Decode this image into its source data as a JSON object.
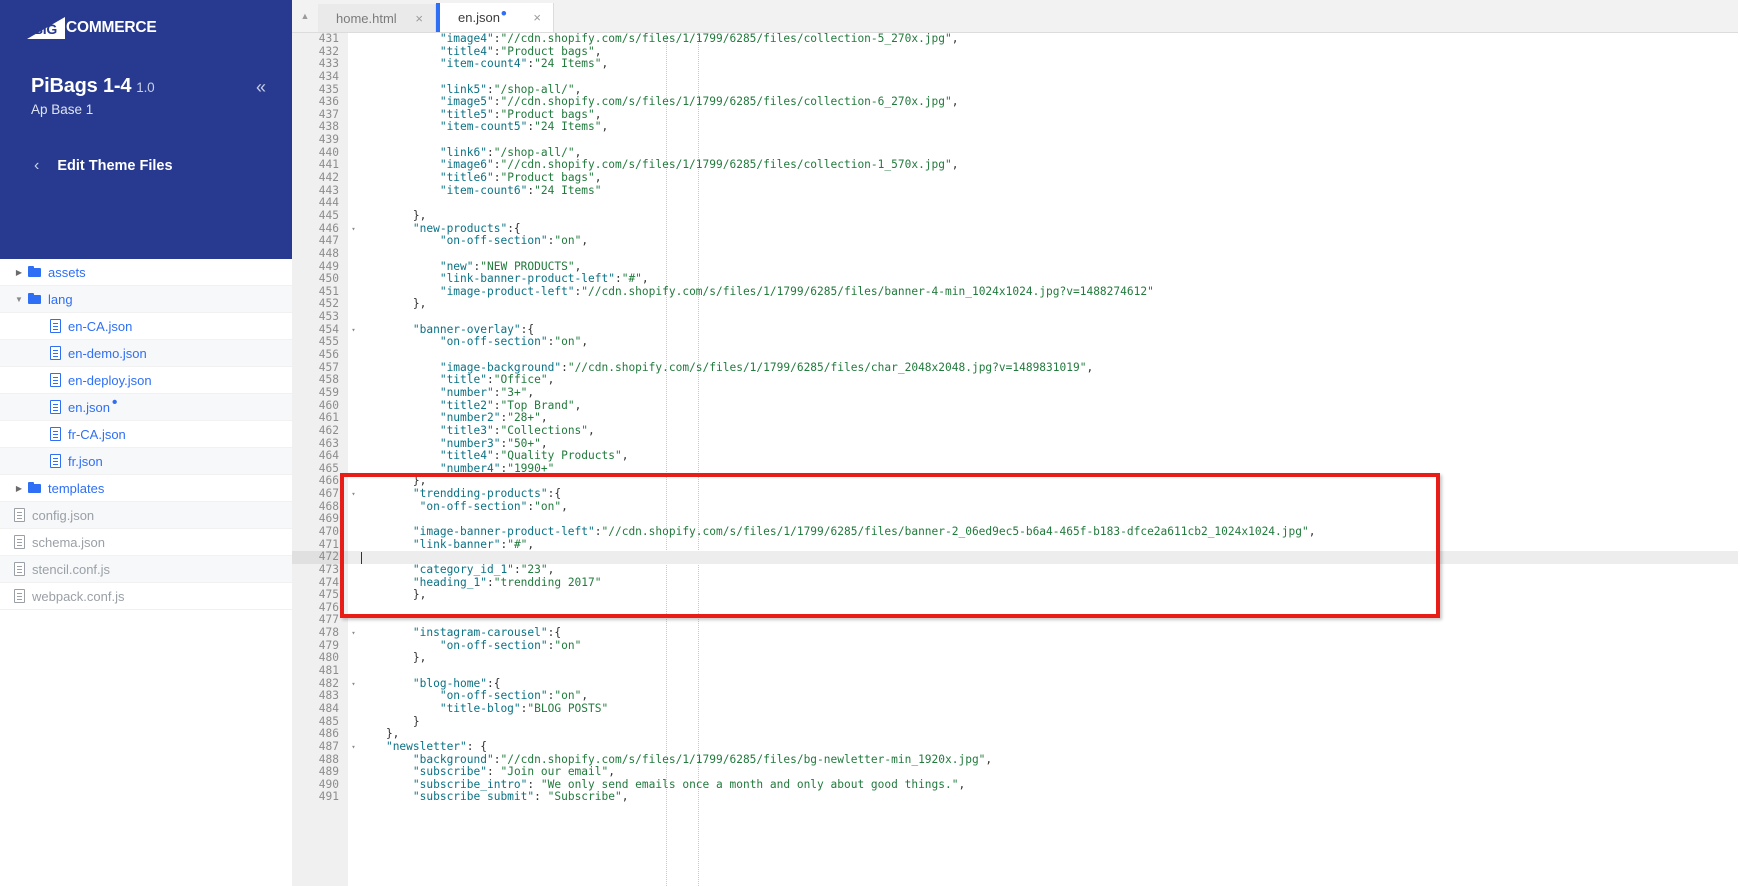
{
  "brand": {
    "logo_big": "BIG",
    "logo_rest": "COMMERCE"
  },
  "sidebar": {
    "theme_name": "PiBags 1-4",
    "theme_version": "1.0",
    "theme_variant": "Ap Base 1",
    "collapse_icon": "double-chevron-left-icon",
    "back_icon": "chevron-left-icon",
    "edit_theme_files_label": "Edit Theme Files",
    "tree": [
      {
        "label": "assets",
        "type": "folder",
        "state": "collapsed",
        "depth": 0,
        "muted": false
      },
      {
        "label": "lang",
        "type": "folder",
        "state": "expanded",
        "depth": 0,
        "muted": false
      },
      {
        "label": "en-CA.json",
        "type": "file",
        "state": "",
        "depth": 1,
        "muted": false
      },
      {
        "label": "en-demo.json",
        "type": "file",
        "state": "",
        "depth": 1,
        "muted": false
      },
      {
        "label": "en-deploy.json",
        "type": "file",
        "state": "",
        "depth": 1,
        "muted": false
      },
      {
        "label": "en.json",
        "type": "file",
        "state": "",
        "depth": 1,
        "muted": false,
        "dirty": true
      },
      {
        "label": "fr-CA.json",
        "type": "file",
        "state": "",
        "depth": 1,
        "muted": false
      },
      {
        "label": "fr.json",
        "type": "file",
        "state": "",
        "depth": 1,
        "muted": false
      },
      {
        "label": "templates",
        "type": "folder",
        "state": "collapsed",
        "depth": 0,
        "muted": false
      },
      {
        "label": "config.json",
        "type": "file",
        "state": "",
        "depth": 0,
        "muted": true
      },
      {
        "label": "schema.json",
        "type": "file",
        "state": "",
        "depth": 0,
        "muted": true
      },
      {
        "label": "stencil.conf.js",
        "type": "file",
        "state": "",
        "depth": 0,
        "muted": true
      },
      {
        "label": "webpack.conf.js",
        "type": "file",
        "state": "",
        "depth": 0,
        "muted": true
      }
    ]
  },
  "editor": {
    "tabs": [
      {
        "label": "home.html",
        "active": false,
        "dirty": false,
        "close_icon": "close-icon"
      },
      {
        "label": "en.json",
        "active": true,
        "dirty": true,
        "close_icon": "close-icon"
      }
    ],
    "scroll_up_icon": "caret-up-icon",
    "first_line_number": 431,
    "cursor_line": 472,
    "highlight_region": {
      "from_line": 466,
      "to_line": 476,
      "color": "#e81d17"
    },
    "lines": [
      {
        "n": 431,
        "fold": "",
        "text": "            \"image4\":\"//cdn.shopify.com/s/files/1/1799/6285/files/collection-5_270x.jpg\","
      },
      {
        "n": 432,
        "fold": "",
        "text": "            \"title4\":\"Product bags\","
      },
      {
        "n": 433,
        "fold": "",
        "text": "            \"item-count4\":\"24 Items\","
      },
      {
        "n": 434,
        "fold": "",
        "text": ""
      },
      {
        "n": 435,
        "fold": "",
        "text": "            \"link5\":\"/shop-all/\","
      },
      {
        "n": 436,
        "fold": "",
        "text": "            \"image5\":\"//cdn.shopify.com/s/files/1/1799/6285/files/collection-6_270x.jpg\","
      },
      {
        "n": 437,
        "fold": "",
        "text": "            \"title5\":\"Product bags\","
      },
      {
        "n": 438,
        "fold": "",
        "text": "            \"item-count5\":\"24 Items\","
      },
      {
        "n": 439,
        "fold": "",
        "text": ""
      },
      {
        "n": 440,
        "fold": "",
        "text": "            \"link6\":\"/shop-all/\","
      },
      {
        "n": 441,
        "fold": "",
        "text": "            \"image6\":\"//cdn.shopify.com/s/files/1/1799/6285/files/collection-1_570x.jpg\","
      },
      {
        "n": 442,
        "fold": "",
        "text": "            \"title6\":\"Product bags\","
      },
      {
        "n": 443,
        "fold": "",
        "text": "            \"item-count6\":\"24 Items\""
      },
      {
        "n": 444,
        "fold": "",
        "text": ""
      },
      {
        "n": 445,
        "fold": "",
        "text": "        },"
      },
      {
        "n": 446,
        "fold": "▾",
        "text": "        \"new-products\":{"
      },
      {
        "n": 447,
        "fold": "",
        "text": "            \"on-off-section\":\"on\","
      },
      {
        "n": 448,
        "fold": "",
        "text": ""
      },
      {
        "n": 449,
        "fold": "",
        "text": "            \"new\":\"NEW PRODUCTS\","
      },
      {
        "n": 450,
        "fold": "",
        "text": "            \"link-banner-product-left\":\"#\","
      },
      {
        "n": 451,
        "fold": "",
        "text": "            \"image-product-left\":\"//cdn.shopify.com/s/files/1/1799/6285/files/banner-4-min_1024x1024.jpg?v=1488274612\""
      },
      {
        "n": 452,
        "fold": "",
        "text": "        },"
      },
      {
        "n": 453,
        "fold": "",
        "text": ""
      },
      {
        "n": 454,
        "fold": "▾",
        "text": "        \"banner-overlay\":{"
      },
      {
        "n": 455,
        "fold": "",
        "text": "            \"on-off-section\":\"on\","
      },
      {
        "n": 456,
        "fold": "",
        "text": ""
      },
      {
        "n": 457,
        "fold": "",
        "text": "            \"image-background\":\"//cdn.shopify.com/s/files/1/1799/6285/files/char_2048x2048.jpg?v=1489831019\","
      },
      {
        "n": 458,
        "fold": "",
        "text": "            \"title\":\"Office\","
      },
      {
        "n": 459,
        "fold": "",
        "text": "            \"number\":\"3+\","
      },
      {
        "n": 460,
        "fold": "",
        "text": "            \"title2\":\"Top Brand\","
      },
      {
        "n": 461,
        "fold": "",
        "text": "            \"number2\":\"28+\","
      },
      {
        "n": 462,
        "fold": "",
        "text": "            \"title3\":\"Collections\","
      },
      {
        "n": 463,
        "fold": "",
        "text": "            \"number3\":\"50+\","
      },
      {
        "n": 464,
        "fold": "",
        "text": "            \"title4\":\"Quality Products\","
      },
      {
        "n": 465,
        "fold": "",
        "text": "            \"number4\":\"1990+\""
      },
      {
        "n": 466,
        "fold": "",
        "text": "        },"
      },
      {
        "n": 467,
        "fold": "▾",
        "text": "        \"trendding-products\":{"
      },
      {
        "n": 468,
        "fold": "",
        "text": "         \"on-off-section\":\"on\","
      },
      {
        "n": 469,
        "fold": "",
        "text": ""
      },
      {
        "n": 470,
        "fold": "",
        "text": "        \"image-banner-product-left\":\"//cdn.shopify.com/s/files/1/1799/6285/files/banner-2_06ed9ec5-b6a4-465f-b183-dfce2a611cb2_1024x1024.jpg\","
      },
      {
        "n": 471,
        "fold": "",
        "text": "        \"link-banner\":\"#\","
      },
      {
        "n": 472,
        "fold": "",
        "text": ""
      },
      {
        "n": 473,
        "fold": "",
        "text": "        \"category_id_1\":\"23\","
      },
      {
        "n": 474,
        "fold": "",
        "text": "        \"heading_1\":\"trendding 2017\""
      },
      {
        "n": 475,
        "fold": "",
        "text": "        },"
      },
      {
        "n": 476,
        "fold": "",
        "text": ""
      },
      {
        "n": 477,
        "fold": "",
        "text": ""
      },
      {
        "n": 478,
        "fold": "▾",
        "text": "        \"instagram-carousel\":{"
      },
      {
        "n": 479,
        "fold": "",
        "text": "            \"on-off-section\":\"on\""
      },
      {
        "n": 480,
        "fold": "",
        "text": "        },"
      },
      {
        "n": 481,
        "fold": "",
        "text": ""
      },
      {
        "n": 482,
        "fold": "▾",
        "text": "        \"blog-home\":{"
      },
      {
        "n": 483,
        "fold": "",
        "text": "            \"on-off-section\":\"on\","
      },
      {
        "n": 484,
        "fold": "",
        "text": "            \"title-blog\":\"BLOG POSTS\""
      },
      {
        "n": 485,
        "fold": "",
        "text": "        }"
      },
      {
        "n": 486,
        "fold": "",
        "text": "    },"
      },
      {
        "n": 487,
        "fold": "▾",
        "text": "    \"newsletter\": {"
      },
      {
        "n": 488,
        "fold": "",
        "text": "        \"background\":\"//cdn.shopify.com/s/files/1/1799/6285/files/bg-newletter-min_1920x.jpg\","
      },
      {
        "n": 489,
        "fold": "",
        "text": "        \"subscribe\": \"Join our email\","
      },
      {
        "n": 490,
        "fold": "",
        "text": "        \"subscribe_intro\": \"We only send emails once a month and only about good things.\","
      },
      {
        "n": 491,
        "fold": "",
        "text": "        \"subscribe submit\": \"Subscribe\","
      }
    ]
  },
  "colors": {
    "brand_navy": "#273a8f",
    "link_blue": "#2f6ff5",
    "string_green": "#227a3d",
    "key_teal": "#0b7285",
    "highlight_red": "#e81d17"
  }
}
